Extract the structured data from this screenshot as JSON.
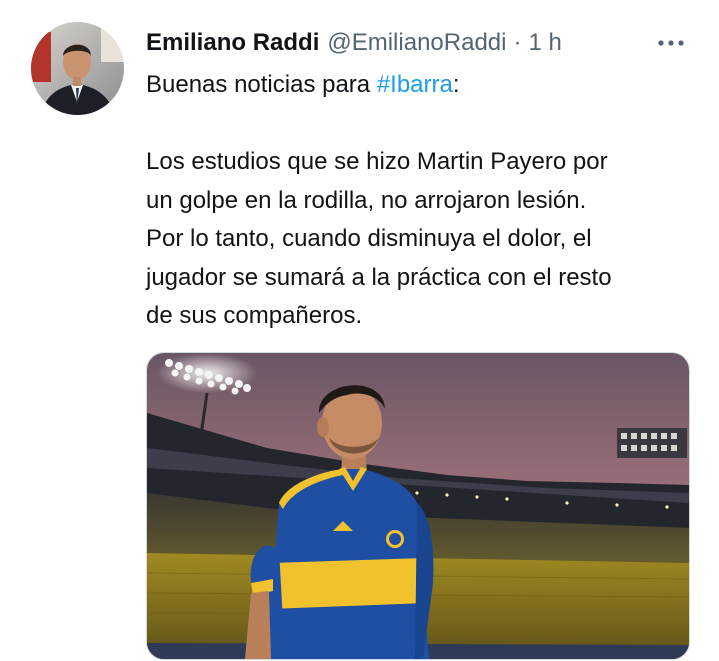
{
  "tweet": {
    "author": {
      "display_name": "Emiliano Raddi",
      "handle": "@EmilianoRaddi",
      "separator": "·",
      "time": "1 h"
    },
    "more_icon": "more-horizontal-icon",
    "text": {
      "intro_before": "Buenas noticias para ",
      "hashtag": "#Ibarra",
      "intro_after": ":",
      "lines": [
        "Los estudios que se hizo Martin Payero por",
        "un golpe en la rodilla, no arrojaron lesión.",
        "Por lo tanto, cuando disminuya el dolor, el",
        "jugador se sumará a la práctica con el resto",
        "de sus compañeros."
      ]
    },
    "colors": {
      "text": "#0f1419",
      "secondary": "#536471",
      "link": "#1d9bf0",
      "jersey_blue": "#1f4fa3",
      "jersey_gold": "#f2c12e"
    }
  }
}
